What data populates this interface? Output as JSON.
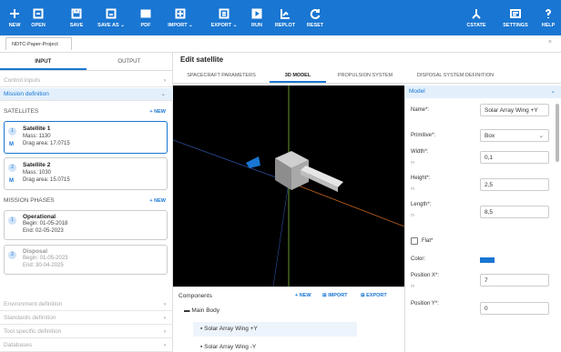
{
  "toolbar": {
    "new": "NEW",
    "open": "OPEN",
    "save": "SAVE",
    "save_as": "SAVE AS ⌄",
    "pdf": "PDF",
    "import": "IMPORT ⌄",
    "export": "EXPORT ⌄",
    "run": "RUN",
    "replot": "REPLOT",
    "reset": "RESET",
    "cstate": "CSTATE",
    "settings": "SETTINGS",
    "help": "HELP"
  },
  "project": {
    "tab": "NDTC-Paper-Project",
    "close": "×"
  },
  "left": {
    "tabs": [
      "INPUT",
      "OUTPUT"
    ],
    "sections_top": [
      {
        "label": "Control inputs",
        "chev": "›"
      },
      {
        "label": "Mission definition",
        "chev": "⌄"
      }
    ],
    "satellites_header": "SATELLITES",
    "new_label": "+ NEW",
    "satellites": [
      {
        "num": "1",
        "name": "Satellite 1",
        "mass": "Mass: 1130",
        "drag": "Drag area: 17.0715",
        "m": "M"
      },
      {
        "num": "2",
        "name": "Satellite 2",
        "mass": "Mass: 1030",
        "drag": "Drag area: 15.0715",
        "m": "M"
      }
    ],
    "phases_header": "MISSION PHASES",
    "phases": [
      {
        "num": "1",
        "name": "Operational",
        "begin": "Begin: 01-05-2018",
        "end": "End: 02-05-2023"
      },
      {
        "num": "2",
        "name": "Disposal",
        "begin": "Begin: 01-05-2023",
        "end": "End: 30-04-2025"
      }
    ],
    "sections_bottom": [
      {
        "label": "Environment definition",
        "chev": "›"
      },
      {
        "label": "Standards definition",
        "chev": "›"
      },
      {
        "label": "Tool specific definition",
        "chev": "›"
      },
      {
        "label": "Databases",
        "chev": "›"
      }
    ]
  },
  "main": {
    "title": "Edit satellite",
    "tabs": [
      "SPACECRAFT PARAMETERS",
      "3D MODEL",
      "PROPULSION SYSTEM",
      "DISPOSAL SYSTEM DEFINITION"
    ],
    "active_tab": "3D MODEL"
  },
  "components": {
    "title": "Components",
    "new": "+ NEW",
    "import": "IMPORT",
    "export": "EXPORT",
    "tree": [
      {
        "label": "Main Body"
      },
      {
        "label": "Solar Array Wing +Y",
        "selected": true
      },
      {
        "label": "Solar Array Wing -Y"
      }
    ]
  },
  "model": {
    "header": "Model",
    "chev": "⌄",
    "name_label": "Name*:",
    "name_value": "Solar Array Wing +Y",
    "primitive_label": "Primitive*:",
    "primitive_value": "Box",
    "primitive_chev": "⌄",
    "width_label": "Width*:",
    "width_unit": "m",
    "width_value": "0,1",
    "height_label": "Height*:",
    "height_unit": "m",
    "height_value": "2,5",
    "length_label": "Length*:",
    "length_unit": "m",
    "length_value": "8,5",
    "flat_label": "Flat*",
    "color_label": "Color:",
    "color_value": "#1976d2",
    "posx_label": "Position X*:",
    "posx_unit": "m",
    "posx_value": "7",
    "posy_label": "Position Y*:",
    "posy_value": "0"
  }
}
